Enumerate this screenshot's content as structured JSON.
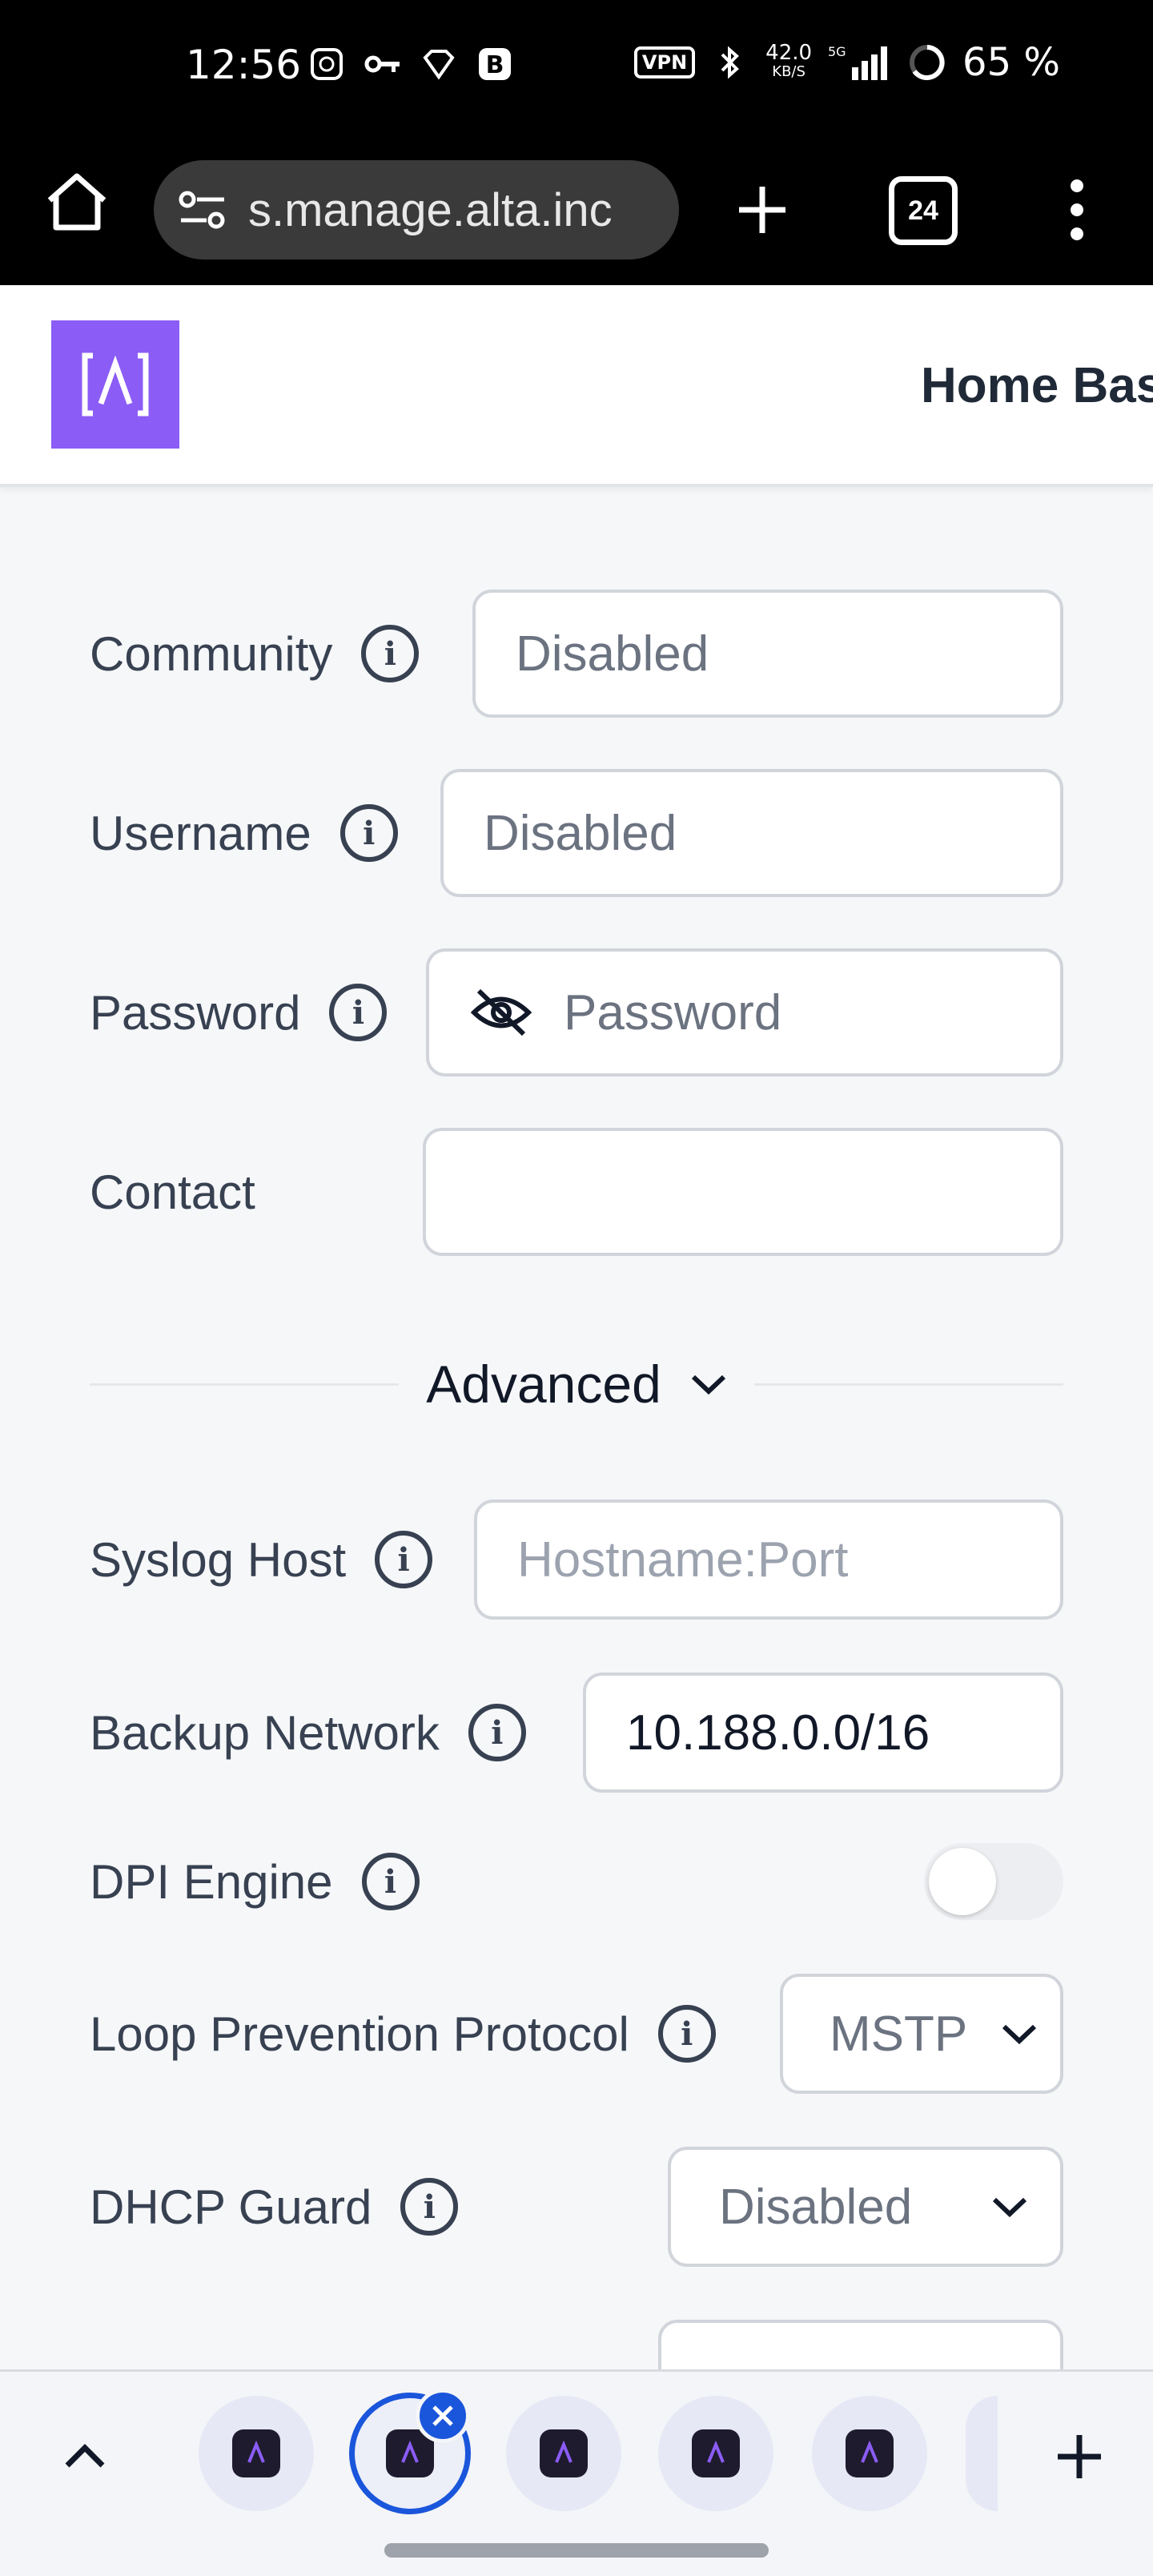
{
  "status_bar": {
    "time": "12:56",
    "vpn_label": "VPN",
    "net_speed_value": "42.0",
    "net_speed_unit": "KB/S",
    "network_type": "5G",
    "battery": "65 %"
  },
  "browser": {
    "url": "s.manage.alta.inc",
    "tab_count": "24"
  },
  "header": {
    "title": "Home Bas"
  },
  "form": {
    "community": {
      "label": "Community",
      "value": "Disabled"
    },
    "username": {
      "label": "Username",
      "value": "Disabled"
    },
    "password": {
      "label": "Password",
      "placeholder": "Password"
    },
    "contact": {
      "label": "Contact",
      "value": ""
    },
    "advanced_label": "Advanced",
    "syslog_host": {
      "label": "Syslog Host",
      "placeholder": "Hostname:Port"
    },
    "backup_network": {
      "label": "Backup Network",
      "value": "10.188.0.0/16"
    },
    "dpi_engine": {
      "label": "DPI Engine",
      "enabled": false
    },
    "loop_prevention": {
      "label": "Loop Prevention Protocol",
      "value": "MSTP"
    },
    "dhcp_guard": {
      "label": "DHCP Guard",
      "value": "Disabled"
    }
  },
  "colors": {
    "brand": "#8b5cf6",
    "tab_active": "#1a56db"
  }
}
